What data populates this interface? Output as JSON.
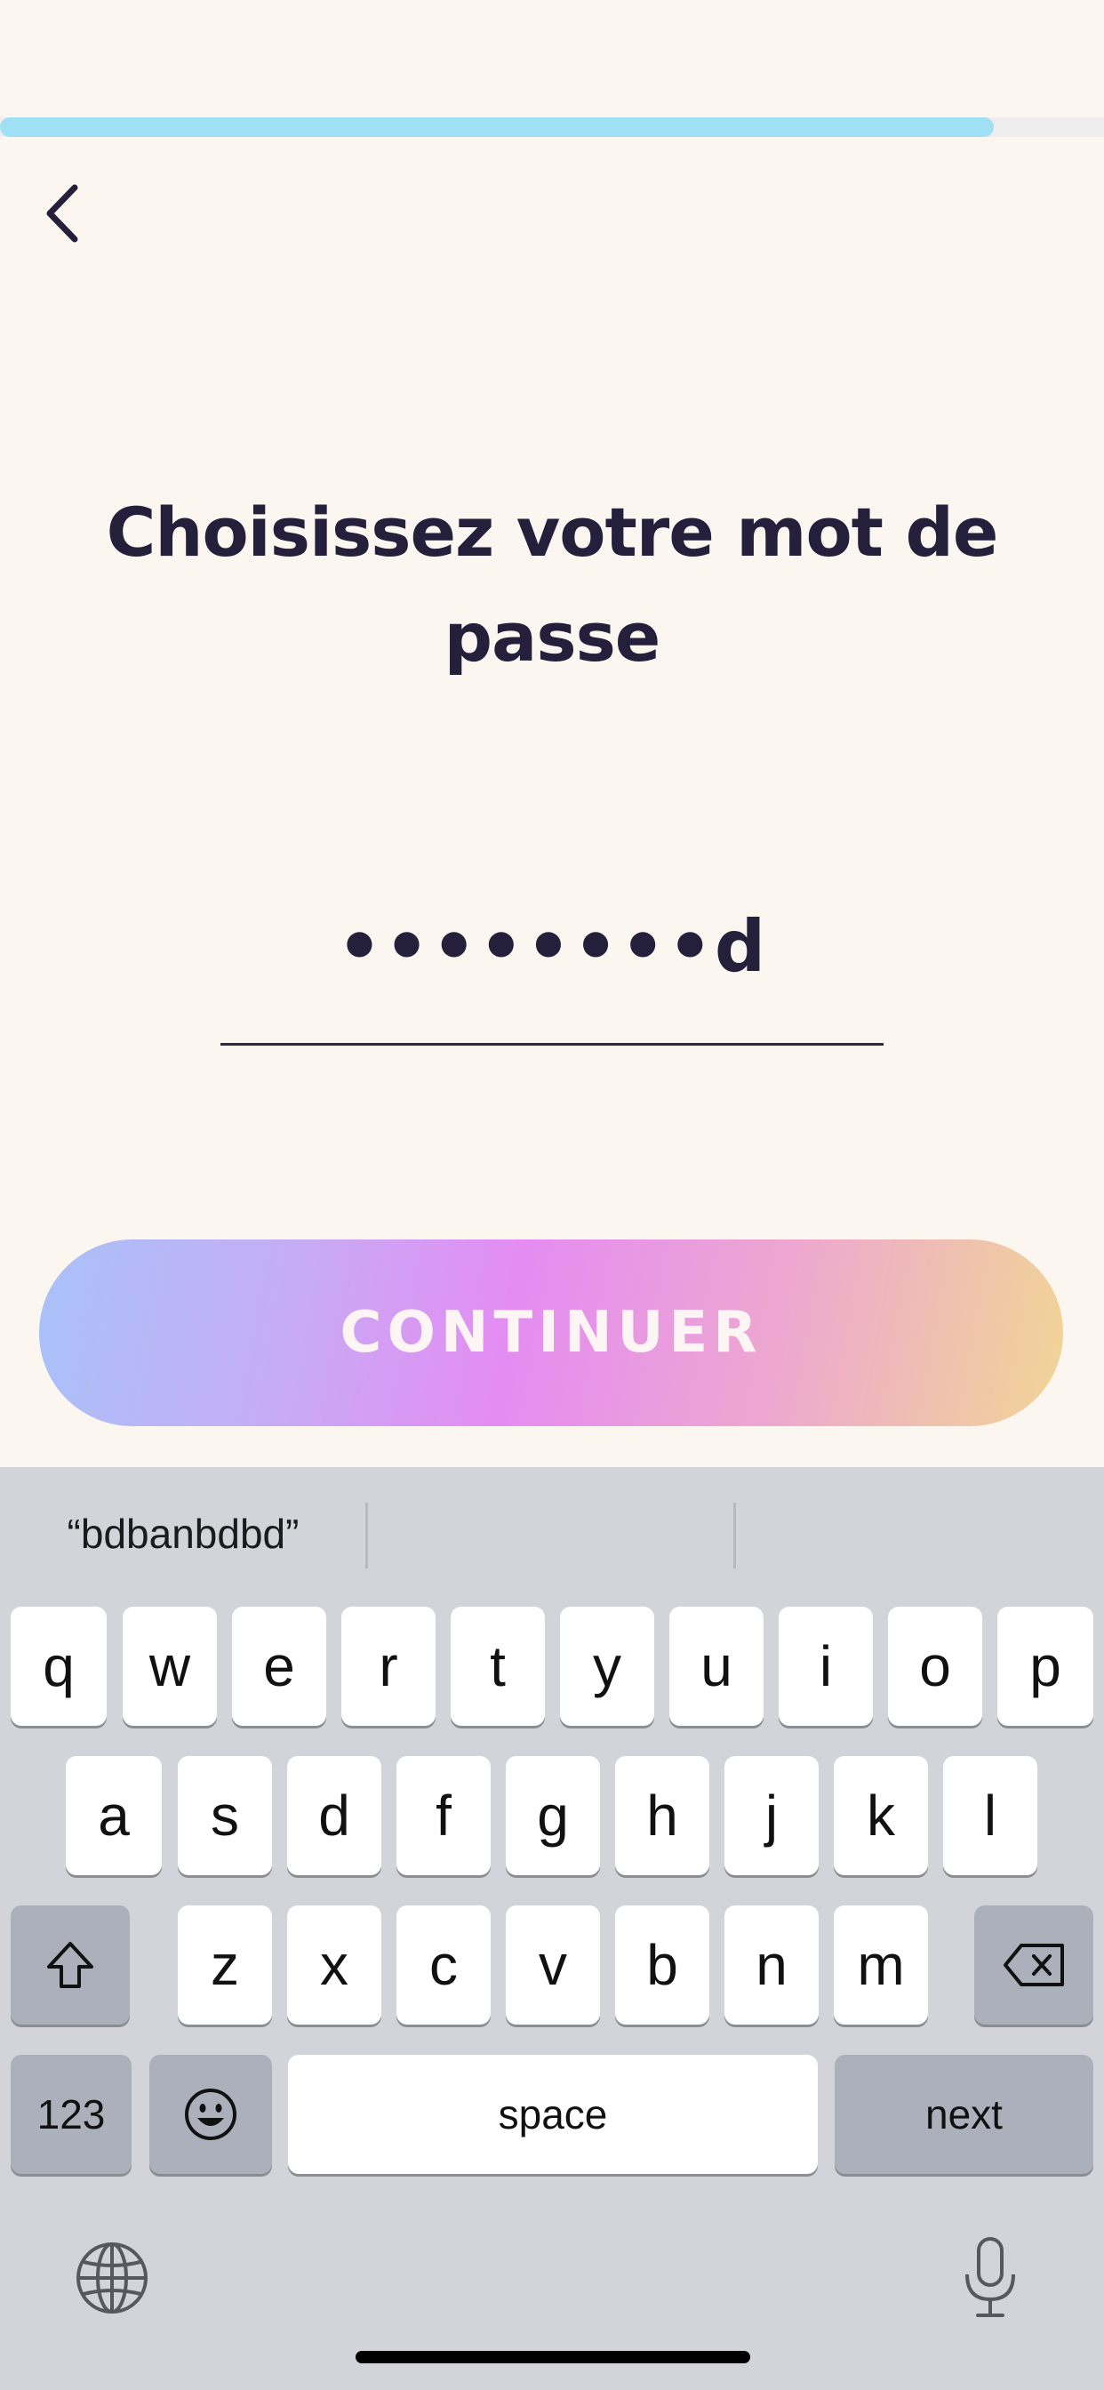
{
  "progress": {
    "fraction": 0.9
  },
  "header": {
    "back_icon": "chevron-left-icon"
  },
  "main": {
    "title": "Choisissez votre mot de passe",
    "password_value": "••••••••d",
    "continue_label": "CONTINUER"
  },
  "keyboard": {
    "suggestions": [
      "“bdbanbdbd”",
      "",
      ""
    ],
    "row1": [
      "q",
      "w",
      "e",
      "r",
      "t",
      "y",
      "u",
      "i",
      "o",
      "p"
    ],
    "row2": [
      "a",
      "s",
      "d",
      "f",
      "g",
      "h",
      "j",
      "k",
      "l"
    ],
    "row3": [
      "z",
      "x",
      "c",
      "v",
      "b",
      "n",
      "m"
    ],
    "numbers_label": "123",
    "space_label": "space",
    "next_label": "next",
    "icons": {
      "shift": "shift-icon",
      "delete": "backspace-icon",
      "emoji": "emoji-icon",
      "globe": "globe-icon",
      "mic": "microphone-icon"
    }
  },
  "colors": {
    "background": "#fbf6f0",
    "text": "#241f3b",
    "progress": "#9fe0f4",
    "keyboard": "#d2d4d9"
  }
}
